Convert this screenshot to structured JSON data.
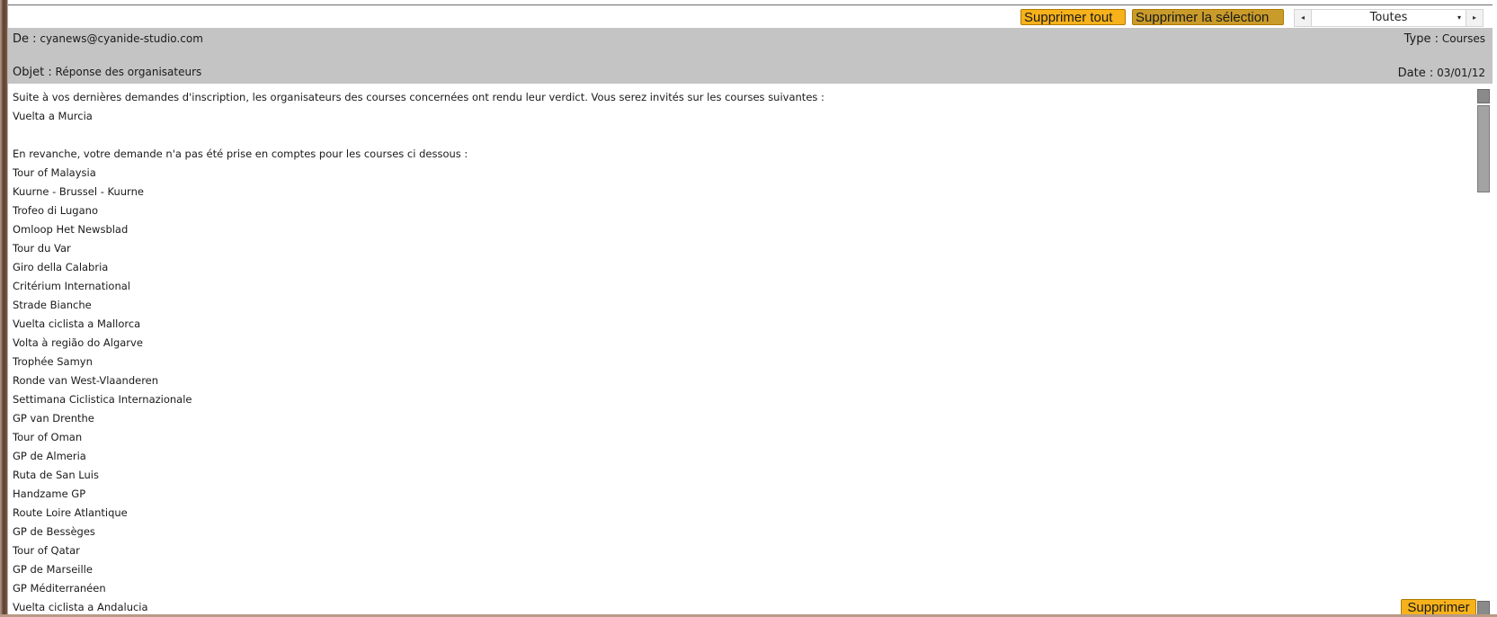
{
  "toolbar": {
    "delete_all_label": "Supprimer tout",
    "delete_selection_label": "Supprimer la sélection",
    "filter": {
      "prev_glyph": "◂",
      "next_glyph": "▸",
      "caret_glyph": "▾",
      "selected": "Toutes"
    }
  },
  "message": {
    "from_label": "De :",
    "from_value": "cyanews@cyanide-studio.com",
    "type_label": "Type :",
    "type_value": "Courses",
    "subject_label": "Objet :",
    "subject_value": "Réponse des organisateurs",
    "date_label": "Date :",
    "date_value": "03/01/12",
    "body_lines": [
      "Suite à vos dernières demandes d'inscription, les organisateurs des courses concernées ont rendu leur verdict. Vous serez invités sur les courses suivantes :",
      "Vuelta a Murcia",
      "",
      "En revanche, votre demande n'a pas été prise en comptes pour les courses ci dessous :",
      "Tour of Malaysia",
      "Kuurne - Brussel - Kuurne",
      "Trofeo di Lugano",
      "Omloop Het Newsblad",
      "Tour du Var",
      "Giro della Calabria",
      "Critérium International",
      "Strade Bianche",
      "Vuelta ciclista a Mallorca",
      "Volta à região do Algarve",
      "Trophée Samyn",
      "Ronde van West-Vlaanderen",
      "Settimana Ciclistica Internazionale",
      "GP van Drenthe",
      "Tour of Oman",
      "GP de Almeria",
      "Ruta de San Luis",
      "Handzame GP",
      "Route Loire Atlantique",
      "GP de Bessèges",
      "Tour of Qatar",
      "GP de Marseille",
      "GP Méditerranéen",
      "Vuelta ciclista a Andalucia"
    ]
  },
  "footer": {
    "delete_label": "Supprimer"
  },
  "colors": {
    "button_accent": "#f7b21b",
    "button_selected": "#c99b2a",
    "header_bg": "#c4c4c4"
  }
}
